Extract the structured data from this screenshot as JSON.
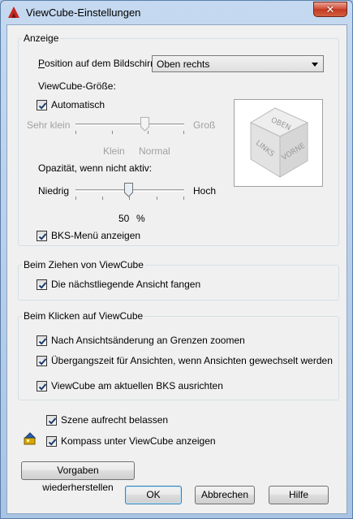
{
  "window": {
    "title": "ViewCube-Einstellungen",
    "close_glyph": "✕"
  },
  "anzeige": {
    "group_label": "Anzeige",
    "position_label": "Position auf dem Bildschirm:",
    "position_value": "Oben rechts",
    "size_label": "ViewCube-Größe:",
    "automatisch_label": "Automatisch",
    "automatisch_checked": true,
    "size_min_label": "Sehr klein",
    "size_max_label": "Groß",
    "size_tick_klein": "Klein",
    "size_tick_normal": "Normal",
    "size_level_percent": 58,
    "opacity_label": "Opazität, wenn nicht aktiv:",
    "opacity_min_label": "Niedrig",
    "opacity_max_label": "Hoch",
    "opacity_value": "50",
    "opacity_unit": "%",
    "bks_menu_label": "BKS-Menü anzeigen",
    "bks_menu_checked": true,
    "cube_faces": {
      "top": "OBEN",
      "left": "LINKS",
      "front": "VORNE"
    }
  },
  "ziehen": {
    "group_label": "Beim Ziehen von ViewCube",
    "snap_label": "Die nächstliegende Ansicht fangen",
    "snap_checked": true
  },
  "klicken": {
    "group_label": "Beim Klicken auf ViewCube",
    "zoom_label": "Nach Ansichtsänderung an Grenzen zoomen",
    "zoom_checked": true,
    "transition_label": "Übergangszeit für Ansichten, wenn Ansichten gewechselt werden",
    "transition_checked": true,
    "align_label": "ViewCube am aktuellen BKS ausrichten",
    "align_checked": true
  },
  "bottom": {
    "upright_label": "Szene aufrecht belassen",
    "upright_checked": true,
    "compass_label": "Kompass unter ViewCube anzeigen",
    "compass_checked": true,
    "restore_button": "Vorgaben wiederherstellen",
    "ok_button": "OK",
    "cancel_button": "Abbrechen",
    "help_button": "Hilfe"
  },
  "colors": {
    "accent_red": "#c8261f",
    "checkmark": "#1c3a6e"
  }
}
